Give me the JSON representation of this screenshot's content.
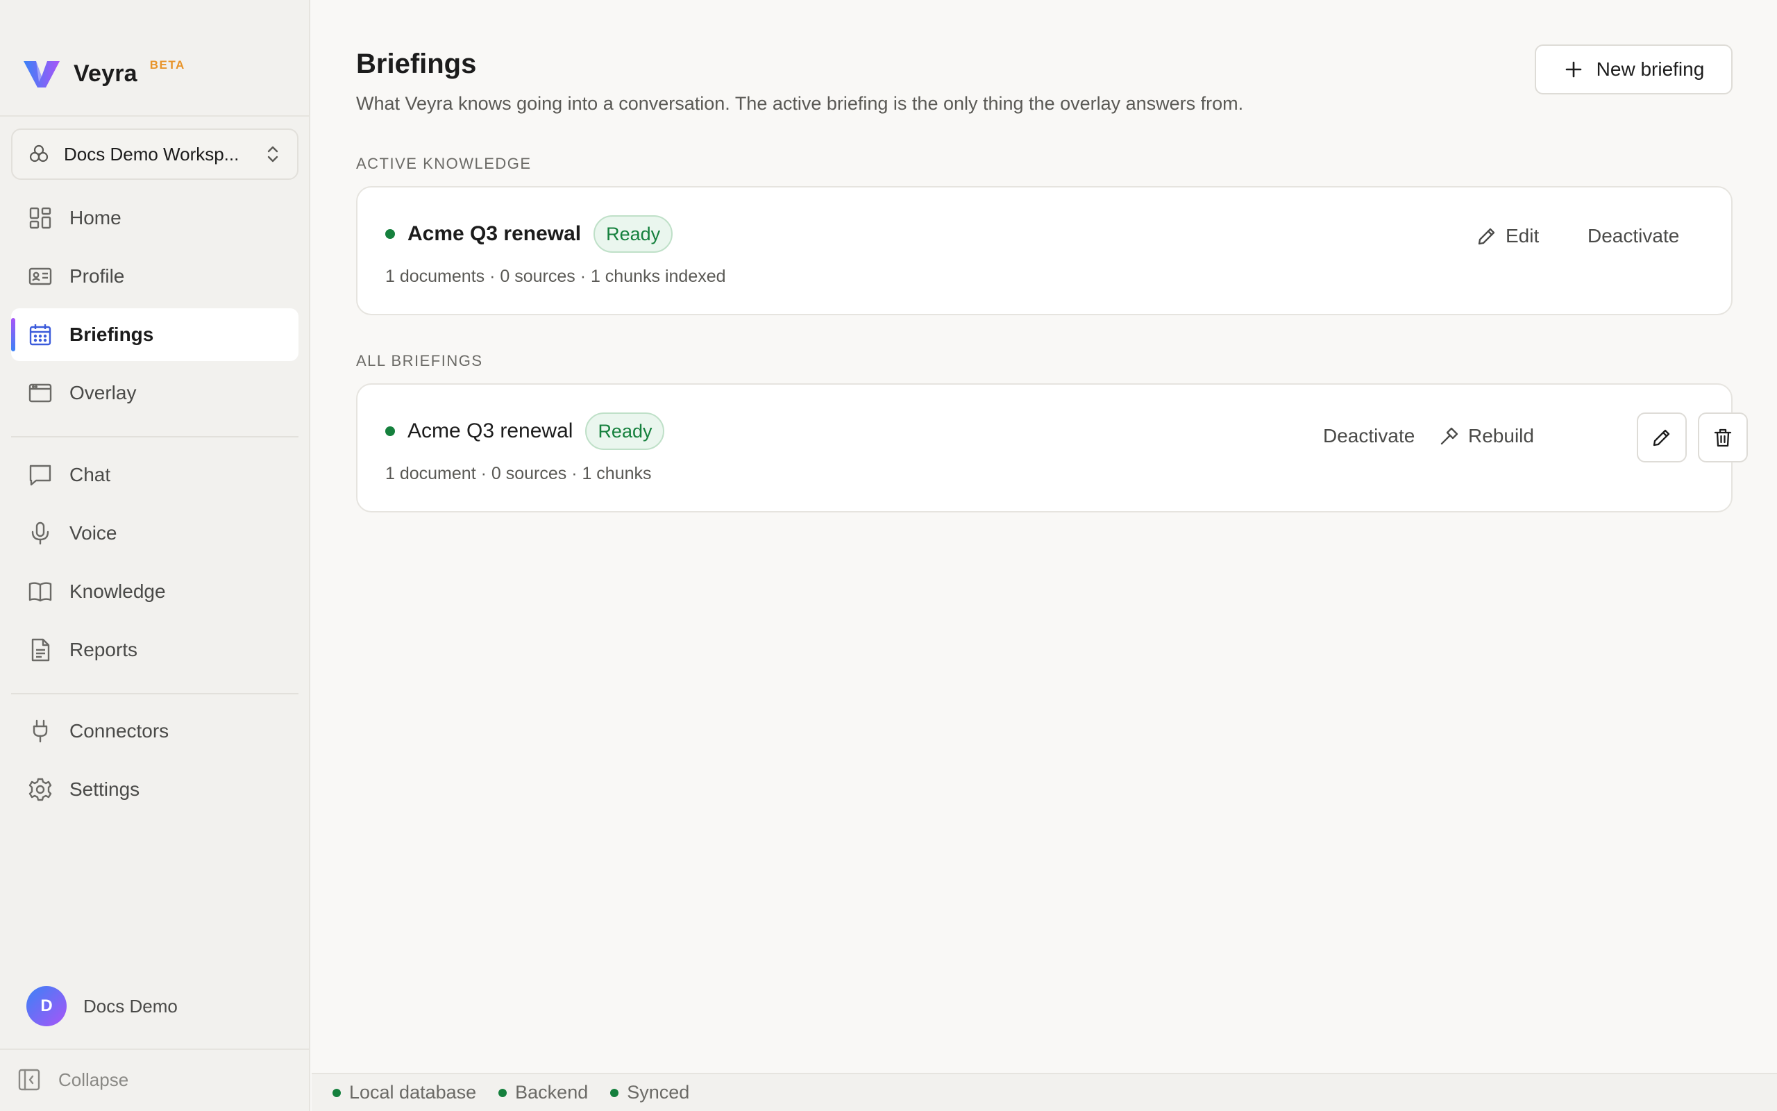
{
  "app": {
    "name": "Veyra",
    "badge": "BETA"
  },
  "workspace": {
    "name": "Docs Demo Worksp...",
    "icon": "workspace-icon"
  },
  "nav": {
    "primary": [
      {
        "label": "Home",
        "icon": "dashboard-icon"
      },
      {
        "label": "Profile",
        "icon": "id-card-icon"
      },
      {
        "label": "Briefings",
        "icon": "calendar-icon",
        "active": true
      },
      {
        "label": "Overlay",
        "icon": "window-icon"
      }
    ],
    "secondary": [
      {
        "label": "Chat",
        "icon": "chat-icon"
      },
      {
        "label": "Voice",
        "icon": "microphone-icon"
      },
      {
        "label": "Knowledge",
        "icon": "book-icon"
      },
      {
        "label": "Reports",
        "icon": "document-icon"
      }
    ],
    "tertiary": [
      {
        "label": "Connectors",
        "icon": "plug-icon"
      },
      {
        "label": "Settings",
        "icon": "gear-icon"
      }
    ]
  },
  "user": {
    "initial": "D",
    "name": "Docs Demo"
  },
  "collapse_label": "Collapse",
  "page": {
    "title": "Briefings",
    "subtitle": "What Veyra knows going into a conversation. The active briefing is the only thing the overlay answers from.",
    "new_button": "New briefing"
  },
  "active_section": {
    "label": "ACTIVE KNOWLEDGE",
    "card": {
      "title": "Acme Q3 renewal",
      "status": "Ready",
      "meta": "1 documents · 0 sources · 1 chunks indexed",
      "edit_label": "Edit",
      "deactivate_label": "Deactivate"
    }
  },
  "all_section": {
    "label": "ALL BRIEFINGS",
    "items": [
      {
        "title": "Acme Q3 renewal",
        "status": "Ready",
        "meta": "1 document · 0 sources · 1 chunks",
        "deactivate_label": "Deactivate",
        "rebuild_label": "Rebuild"
      }
    ]
  },
  "statusbar": [
    {
      "label": "Local database"
    },
    {
      "label": "Backend"
    },
    {
      "label": "Synced"
    }
  ],
  "colors": {
    "accent_green": "#15803d",
    "beta_orange": "#e8942a",
    "active_blue": "#3b5bdb"
  }
}
